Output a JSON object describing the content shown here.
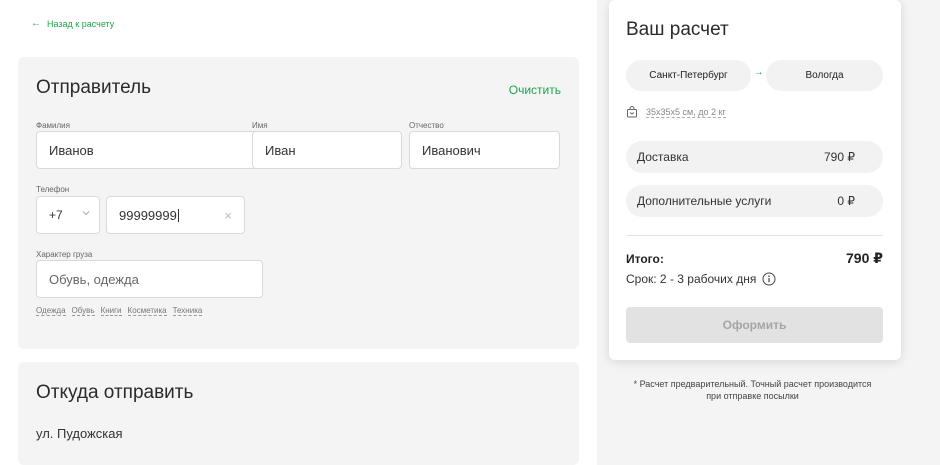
{
  "nav": {
    "back_label": "Назад к расчету"
  },
  "sender": {
    "title": "Отправитель",
    "clear_label": "Очистить",
    "lastname": {
      "label": "Фамилия",
      "value": "Иванов"
    },
    "firstname": {
      "label": "Имя",
      "value": "Иван"
    },
    "patronymic": {
      "label": "Отчество",
      "value": "Иванович"
    },
    "phone": {
      "label": "Телефон",
      "code": "+7",
      "number": "99999999"
    },
    "cargo": {
      "label": "Характер груза",
      "placeholder": "Обувь, одежда"
    },
    "cargo_tags": [
      "Одежда",
      "Обувь",
      "Книги",
      "Косметика",
      "Техника"
    ]
  },
  "from": {
    "title": "Откуда отправить",
    "address": "ул. Пудожская"
  },
  "calc": {
    "title": "Ваш расчет",
    "city_from": "Санкт-Петербург",
    "city_to": "Вологда",
    "package": "35х35х5 см, до 2 кг",
    "delivery_label": "Доставка",
    "delivery_price": "790 ₽",
    "extra_label": "Дополнительные услуги",
    "extra_price": "0 ₽",
    "total_label": "Итого:",
    "total_value": "790 ₽",
    "term": "Срок: 2 - 3 рабочих дня",
    "order_button": "Оформить",
    "note": "* Расчет предварительный. Точный расчет производится при отправке посылки"
  },
  "colors": {
    "accent": "#1aa64b",
    "panel": "#f4f4f4"
  }
}
